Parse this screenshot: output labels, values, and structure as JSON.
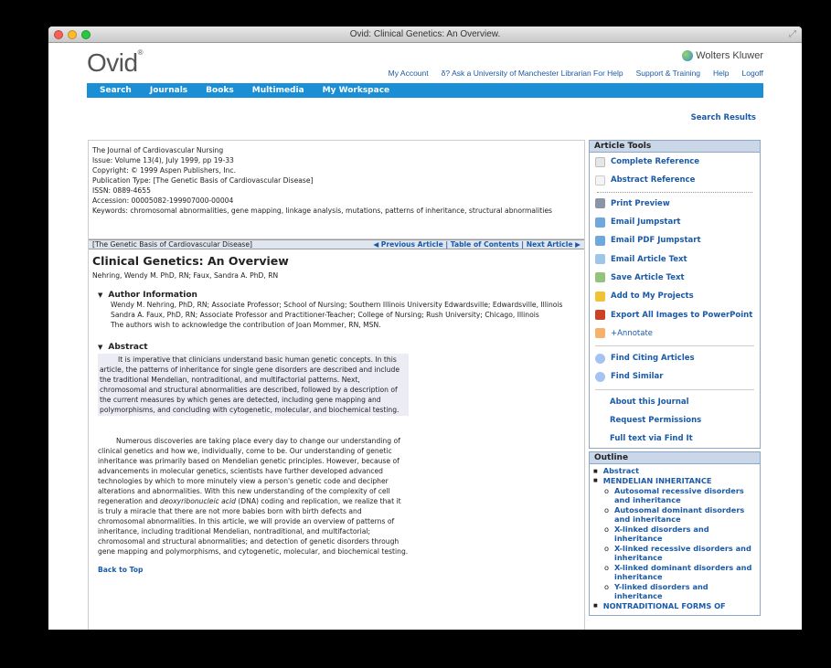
{
  "window": {
    "title": "Ovid: Clinical Genetics: An Overview."
  },
  "header": {
    "logo": "Ovid",
    "logo_mark": "®",
    "brand": "Wolters Kluwer",
    "links": [
      "My Account",
      "Ask a University of Manchester Librarian For Help",
      "Support & Training",
      "Help",
      "Logoff"
    ]
  },
  "nav": {
    "items": [
      "Search",
      "Journals",
      "Books",
      "Multimedia",
      "My Workspace"
    ]
  },
  "search_results": "Search Results",
  "meta": {
    "journal": "The Journal of Cardiovascular Nursing",
    "issue": "Issue: Volume 13(4), July 1999, pp 19-33",
    "copyright": "Copyright: © 1999 Aspen Publishers, Inc.",
    "pubtype": "Publication Type: [The Genetic Basis of Cardiovascular Disease]",
    "issn": "ISSN: 0889-4655",
    "accession": "Accession: 00005082-199907000-00004",
    "keywords": "Keywords: chromosomal abnormalities, gene mapping, linkage analysis, mutations, patterns of inheritance, structural abnormalities"
  },
  "bar": {
    "section": "[The Genetic Basis of Cardiovascular Disease]",
    "prev": "◀ Previous Article",
    "sep1": " | ",
    "toc": "Table of Contents",
    "sep2": " | ",
    "next": "Next Article ▶"
  },
  "article": {
    "title": "Clinical Genetics: An Overview",
    "authors": "Nehring, Wendy M. PhD, RN; Faux, Sandra A. PhD, RN",
    "author_info_heading": "Author Information",
    "author1": "Wendy M. Nehring, PhD, RN; Associate Professor; School of Nursing; Southern Illinois University Edwardsville; Edwardsville, Illinois",
    "author2": "Sandra A. Faux, PhD, RN; Associate Professor and Practitioner-Teacher; College of Nursing; Rush University; Chicago, Illinois",
    "ack": "The authors wish to acknowledge the contribution of Joan Mommer, RN, MSN.",
    "abstract_heading": "Abstract",
    "abstract": "It is imperative that clinicians understand basic human genetic concepts. In this article, the patterns of inheritance for single gene disorders are described and include the traditional Mendelian, nontraditional, and multifactorial patterns. Next, chromosomal and structural abnormalities are described, followed by a description of the current measures by which genes are detected, including gene mapping and polymorphisms, and concluding with cytogenetic, molecular, and biochemical testing.",
    "body_1": "Numerous discoveries are taking place every day to change our understanding of clinical genetics and how we, individually, come to be. Our understanding of genetic inheritance was primarily based on Mendelian genetic principles. However, because of advancements in molecular genetics, scientists have further developed advanced technologies by which to more minutely view a person's genetic code and decipher alterations and abnormalities. With this new understanding of the complexity of cell regeneration and ",
    "body_em": "deoxyribonucleic acid",
    "body_2": " (DNA) coding and replication, we realize that it is truly a miracle that there are not more babies born with birth defects and chromosomal abnormalities. In this article, we will provide an overview of patterns of inheritance, including traditional Mendelian, nontraditional, and multifactorial; chromosomal and structural abnormalities; and detection of genetic disorders through gene mapping and polymorphisms, and cytogenetic, molecular, and biochemical testing.",
    "back_to_top": "Back to Top"
  },
  "tools": {
    "heading": "Article Tools",
    "complete_ref": "Complete Reference",
    "abstract_ref": "Abstract Reference",
    "print": "Print Preview",
    "email_jump": "Email Jumpstart",
    "email_pdf": "Email PDF Jumpstart",
    "email_text": "Email Article Text",
    "save_text": "Save Article Text",
    "add_projects": "Add to My Projects",
    "export_ppt": "Export All Images to PowerPoint",
    "annotate": "+Annotate",
    "find_citing": "Find Citing Articles",
    "find_similar": "Find Similar",
    "about_journal": "About this Journal",
    "request_perm": "Request Permissions",
    "full_text": "Full text via Find It"
  },
  "outline": {
    "heading": "Outline",
    "abstract": "Abstract",
    "mendelian": "MENDELIAN INHERITANCE",
    "subs": [
      "Autosomal recessive disorders and inheritance",
      "Autosomal dominant disorders and inheritance",
      "X-linked disorders and inheritance",
      "X-linked recessive disorders and inheritance",
      "X-linked dominant disorders and inheritance",
      "Y-linked disorders and inheritance"
    ],
    "nontraditional": "NONTRADITIONAL FORMS OF"
  },
  "colors": {
    "nav": "#1a8fd6",
    "link": "#1a5aa8",
    "panel_header": "#c9d7e8",
    "abstract_bg": "#ececf4"
  }
}
